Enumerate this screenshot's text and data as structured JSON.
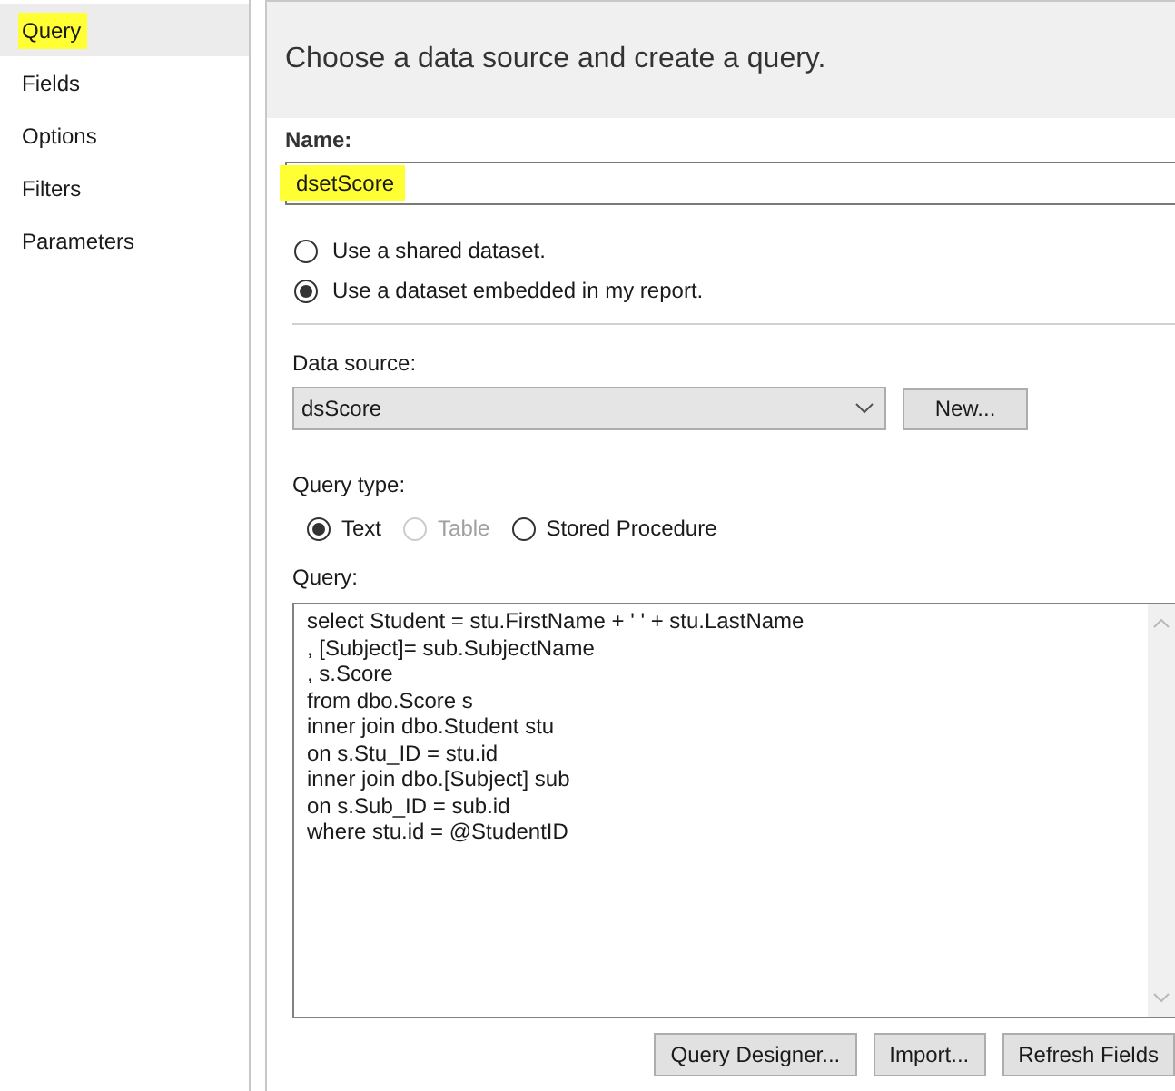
{
  "sidebar": {
    "items": [
      {
        "label": "Query",
        "selected": true,
        "highlighted": true
      },
      {
        "label": "Fields",
        "selected": false,
        "highlighted": false
      },
      {
        "label": "Options",
        "selected": false,
        "highlighted": false
      },
      {
        "label": "Filters",
        "selected": false,
        "highlighted": false
      },
      {
        "label": "Parameters",
        "selected": false,
        "highlighted": false
      }
    ]
  },
  "header": {
    "title": "Choose a data source and create a query."
  },
  "name_field": {
    "label": "Name:",
    "value": "dsetScore",
    "highlighted": true
  },
  "dataset_options": [
    {
      "label": "Use a shared dataset.",
      "selected": false
    },
    {
      "label": "Use a dataset embedded in my report.",
      "selected": true
    }
  ],
  "data_source": {
    "label": "Data source:",
    "value": "dsScore",
    "button": "New..."
  },
  "query_type": {
    "label": "Query type:",
    "options": [
      {
        "label": "Text",
        "selected": true,
        "disabled": false
      },
      {
        "label": "Table",
        "selected": false,
        "disabled": true
      },
      {
        "label": "Stored Procedure",
        "selected": false,
        "disabled": false
      }
    ]
  },
  "query": {
    "label": "Query:",
    "lines": [
      "select Student = stu.FirstName + ' ' + stu.LastName",
      ", [Subject]= sub.SubjectName",
      ", s.Score",
      "from dbo.Score s",
      "inner join dbo.Student stu",
      "on s.Stu_ID = stu.id",
      "inner join dbo.[Subject] sub",
      "on s.Sub_ID = sub.id",
      "where stu.id = @StudentID"
    ]
  },
  "buttons": [
    "Query Designer...",
    "Import...",
    "Refresh Fields"
  ]
}
